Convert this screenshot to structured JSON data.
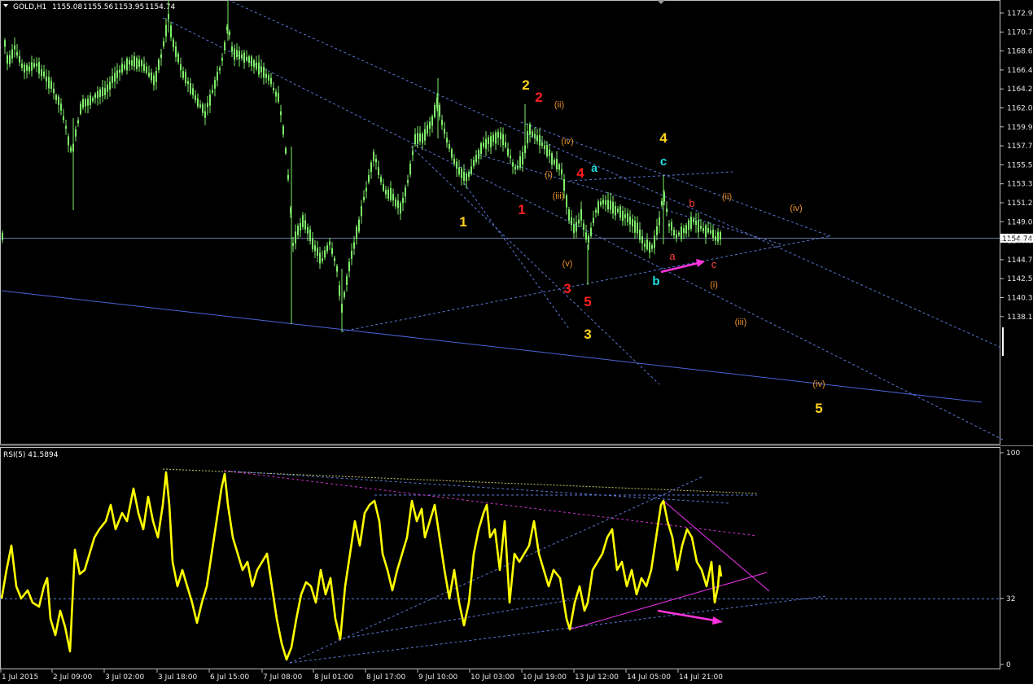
{
  "window": {
    "symbol_header": "GOLD,H1",
    "ohlc": [
      "1155.08",
      "1155.56",
      "1153.95",
      "1154.74"
    ],
    "rsi_header": "RSI(5) 41.5894"
  },
  "colors": {
    "background": "#000000",
    "candle": "#7ff06a",
    "rsi_line": "#ffff00",
    "grid_line": "#6c7fc0",
    "trend_dash": "#5c79d6",
    "trend_solid": "#4a63d8",
    "magenta": "#ff33dd",
    "price_tag_bg": "#ffffff"
  },
  "price_axis": {
    "ticks": [
      "1172.95",
      "1170.75",
      "1168.60",
      "1166.40",
      "1164.25",
      "1162.05",
      "1159.90",
      "1157.70",
      "1155.55",
      "1153.35",
      "1151.20",
      "1149.05",
      "1146.85",
      "1144.70",
      "1142.50",
      "1140.35",
      "1138.15"
    ],
    "current_price": "1154.74"
  },
  "rsi_axis": {
    "ticks": [
      "100",
      "32",
      "0"
    ]
  },
  "time_axis": {
    "labels": [
      "1 Jul 2015",
      "2 Jul 09:00",
      "3 Jul 02:00",
      "3 Jul 18:00",
      "6 Jul 15:00",
      "7 Jul 08:00",
      "8 Jul 01:00",
      "8 Jul 17:00",
      "9 Jul 10:00",
      "10 Jul 03:00",
      "10 Jul 19:00",
      "13 Jul 12:00",
      "14 Jul 05:00",
      "14 Jul 21:00"
    ]
  },
  "wave_labels": [
    {
      "text": "2",
      "color": "#ffd21e",
      "size": 17
    },
    {
      "text": "2",
      "color": "#ff2020",
      "size": 17
    },
    {
      "text": "(ii)",
      "color": "#e8902a",
      "size": 11
    },
    {
      "text": "(iv)",
      "color": "#e8902a",
      "size": 11
    },
    {
      "text": "(i)",
      "color": "#e8902a",
      "size": 11
    },
    {
      "text": "(iii)",
      "color": "#e8902a",
      "size": 11
    },
    {
      "text": "(v)",
      "color": "#e8902a",
      "size": 11
    },
    {
      "text": "4",
      "color": "#ff2020",
      "size": 17
    },
    {
      "text": "a",
      "color": "#22e0e0",
      "size": 14
    },
    {
      "text": "4",
      "color": "#ffd21e",
      "size": 17
    },
    {
      "text": "c",
      "color": "#22e0e0",
      "size": 15
    },
    {
      "text": "b",
      "color": "#ff4040",
      "size": 13
    },
    {
      "text": "(ii)",
      "color": "#e8902a",
      "size": 11
    },
    {
      "text": "(iv)",
      "color": "#e8902a",
      "size": 11
    },
    {
      "text": "1",
      "color": "#ffd21e",
      "size": 17
    },
    {
      "text": "1",
      "color": "#ff2020",
      "size": 17
    },
    {
      "text": "3",
      "color": "#ff2020",
      "size": 17
    },
    {
      "text": "5",
      "color": "#ff2020",
      "size": 17
    },
    {
      "text": "3",
      "color": "#ffd21e",
      "size": 17
    },
    {
      "text": "a",
      "color": "#ff4040",
      "size": 13
    },
    {
      "text": "c",
      "color": "#ff4040",
      "size": 13
    },
    {
      "text": "b",
      "color": "#22e0e0",
      "size": 15
    },
    {
      "text": "(i)",
      "color": "#e8902a",
      "size": 11
    },
    {
      "text": "(iii)",
      "color": "#e8902a",
      "size": 11
    },
    {
      "text": "(iv)",
      "color": "#e8902a",
      "size": 11
    },
    {
      "text": "5",
      "color": "#ffd21e",
      "size": 17
    }
  ]
}
